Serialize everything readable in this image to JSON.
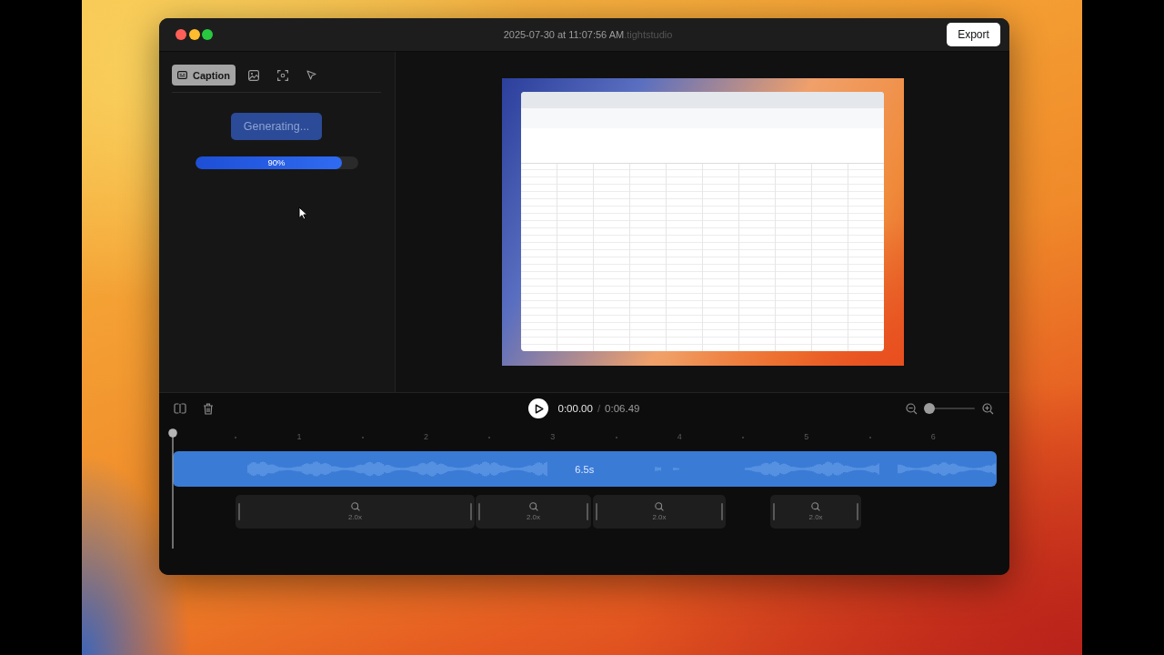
{
  "window": {
    "title": "2025-07-30 at 11:07:56 AM",
    "file_extension": ".tightstudio",
    "export_button": "Export"
  },
  "sidebar": {
    "tabs": [
      {
        "kind": "caption",
        "label": "Caption",
        "selected": true
      },
      {
        "kind": "image",
        "selected": false
      },
      {
        "kind": "focus",
        "selected": false
      },
      {
        "kind": "cursor",
        "selected": false
      }
    ],
    "generate_button": {
      "label": "Generating...",
      "disabled": true
    },
    "progress": {
      "level": 0.9,
      "reading": "90%"
    }
  },
  "timeline": {
    "current_time": "0:00.00",
    "separator": "/",
    "duration": "0:06.49",
    "zoom_slider": {
      "level": 0
    },
    "ruler_labels": [
      "1",
      "2",
      "3",
      "4",
      "5",
      "6"
    ],
    "clip": {
      "label": "6.5s"
    },
    "zoom_segments": [
      {
        "label": "2.0x"
      },
      {
        "label": "2.0x"
      },
      {
        "label": "2.0x"
      },
      {
        "label": "2.0x"
      }
    ]
  }
}
